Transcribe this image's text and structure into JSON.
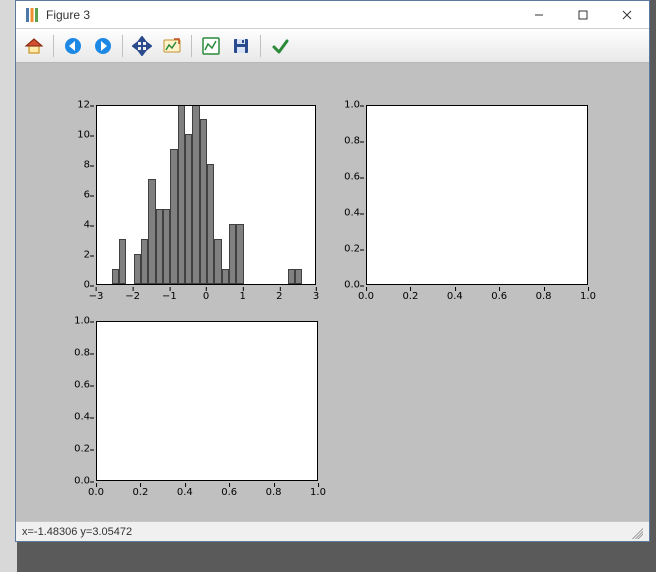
{
  "window": {
    "title": "Figure 3"
  },
  "toolbar": {
    "home": "Home",
    "back": "Back",
    "forward": "Forward",
    "pan": "Pan",
    "zoom": "Zoom",
    "subplots": "Configure subplots",
    "save": "Save",
    "edit": "Edit parameters"
  },
  "status": {
    "coords": "x=-1.48306      y=3.05472"
  },
  "chart_data": [
    {
      "type": "bar",
      "position": "top-left",
      "title": "",
      "xlabel": "",
      "ylabel": "",
      "xlim": [
        -3,
        3
      ],
      "ylim": [
        0,
        12
      ],
      "xticks": [
        -3,
        -2,
        -1,
        0,
        1,
        2,
        3
      ],
      "yticks": [
        0,
        2,
        4,
        6,
        8,
        10,
        12
      ],
      "bin_edges": [
        -2.6,
        -2.4,
        -2.2,
        -2.0,
        -1.8,
        -1.6,
        -1.4,
        -1.2,
        -1.0,
        -0.8,
        -0.6,
        -0.4,
        -0.2,
        0.0,
        0.2,
        0.4,
        0.6,
        0.8,
        1.0,
        1.2,
        1.4,
        1.6,
        1.8,
        2.0,
        2.2,
        2.4,
        2.6
      ],
      "values": [
        1,
        3,
        0,
        2,
        3,
        7,
        5,
        5,
        9,
        12,
        10,
        12,
        11,
        8,
        3,
        1,
        4,
        4,
        0,
        0,
        0,
        0,
        0,
        0,
        1,
        1
      ]
    },
    {
      "type": "line",
      "position": "top-right",
      "title": "",
      "xlabel": "",
      "ylabel": "",
      "xlim": [
        0.0,
        1.0
      ],
      "ylim": [
        0.0,
        1.0
      ],
      "xticks": [
        0.0,
        0.2,
        0.4,
        0.6,
        0.8,
        1.0
      ],
      "yticks": [
        0.0,
        0.2,
        0.4,
        0.6,
        0.8,
        1.0
      ],
      "series": []
    },
    {
      "type": "line",
      "position": "bottom-left",
      "title": "",
      "xlabel": "",
      "ylabel": "",
      "xlim": [
        0.0,
        1.0
      ],
      "ylim": [
        0.0,
        1.0
      ],
      "xticks": [
        0.0,
        0.2,
        0.4,
        0.6,
        0.8,
        1.0
      ],
      "yticks": [
        0.0,
        0.2,
        0.4,
        0.6,
        0.8,
        1.0
      ],
      "series": []
    }
  ]
}
